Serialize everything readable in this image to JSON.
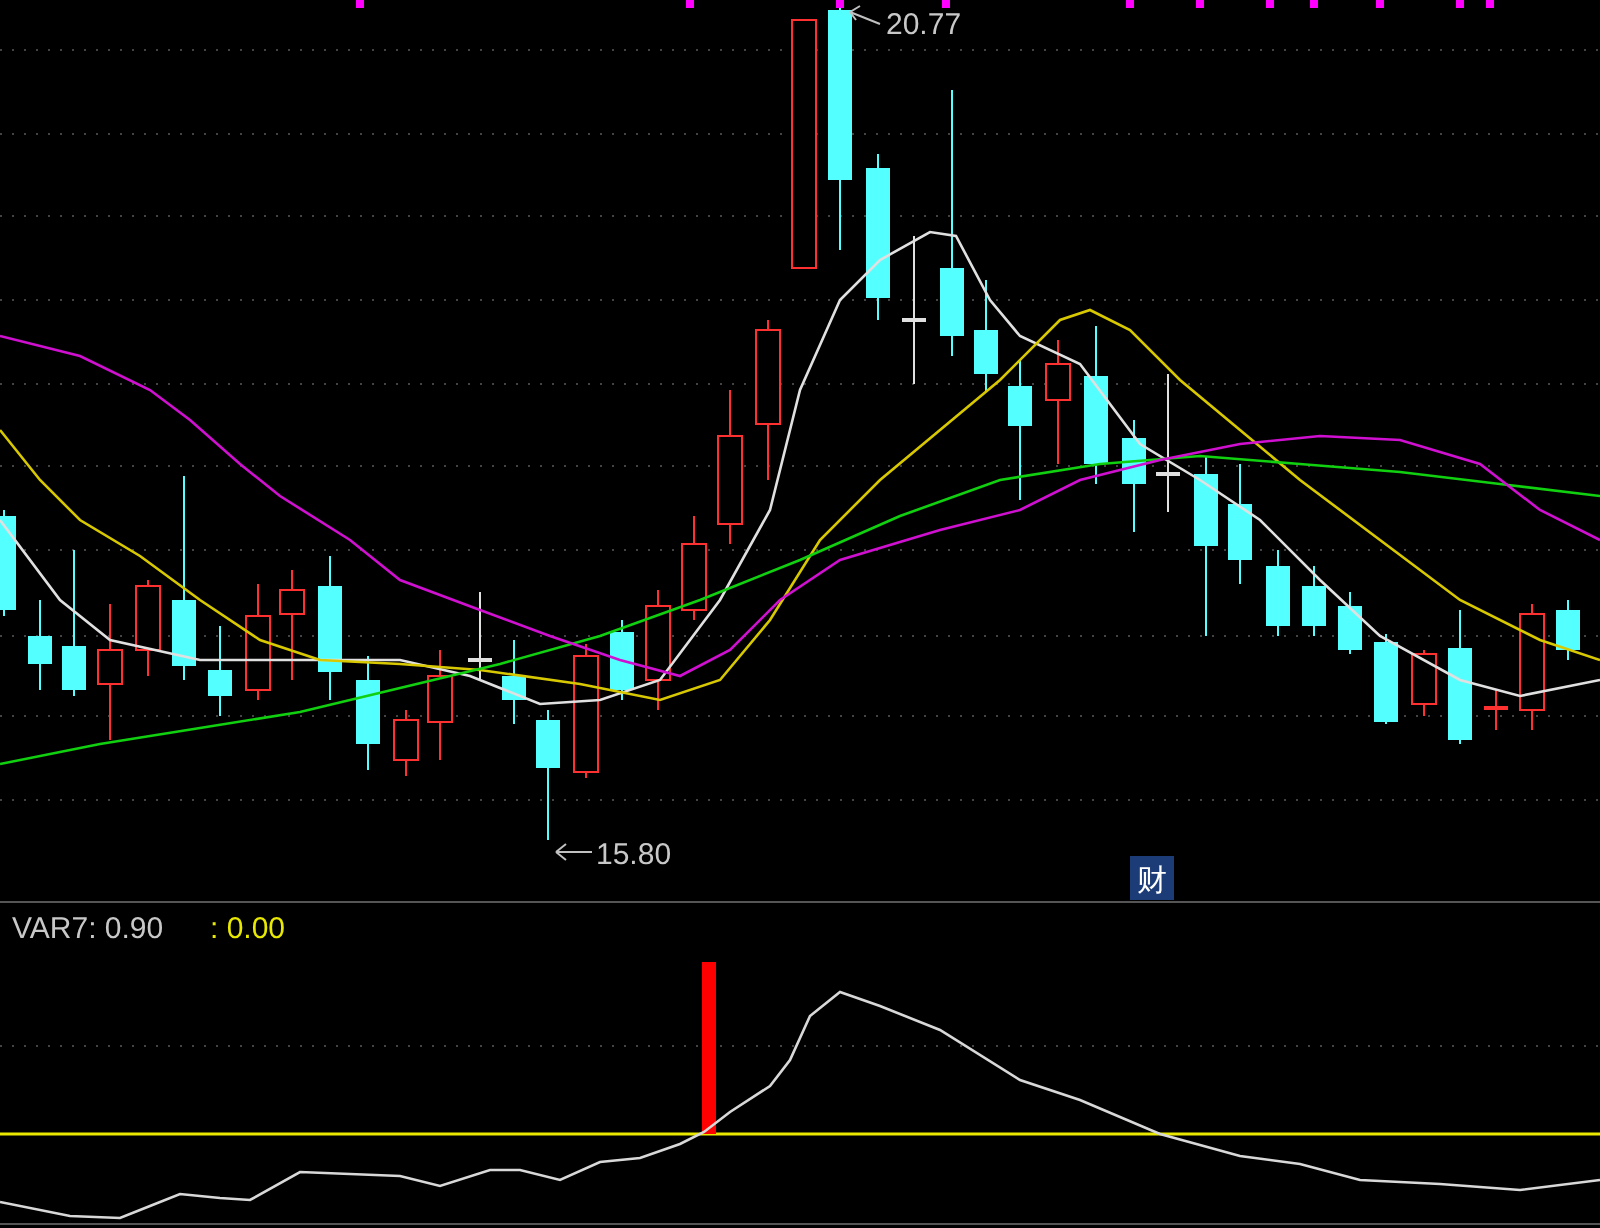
{
  "price_chart": {
    "high_label": "20.77",
    "low_label": "15.80",
    "badge": "财"
  },
  "indicator_panel": {
    "name_value": "VAR7: 0.90",
    "signal_value": ": 0.00"
  }
}
